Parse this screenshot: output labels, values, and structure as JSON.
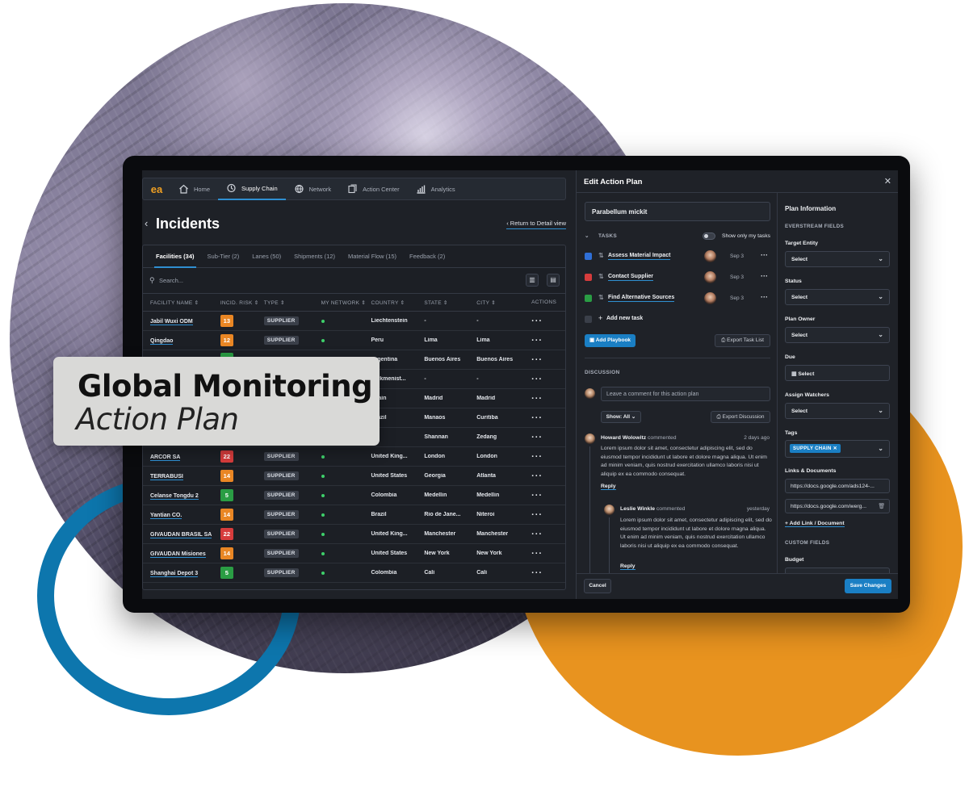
{
  "overlay": {
    "line1": "Global Monitoring",
    "line2": "Action Plan"
  },
  "nav": {
    "logo": "ea",
    "items": [
      {
        "label": "Home",
        "icon": "home-icon"
      },
      {
        "label": "Supply Chain",
        "icon": "supply-chain-icon",
        "active": true
      },
      {
        "label": "Network",
        "icon": "network-icon"
      },
      {
        "label": "Action Center",
        "icon": "action-center-icon"
      },
      {
        "label": "Analytics",
        "icon": "analytics-icon"
      }
    ]
  },
  "page": {
    "title": "Incidents",
    "return_link": "Return to Detail view"
  },
  "tabs": [
    "Facilities (34)",
    "Sub-Tier (2)",
    "Lanes (50)",
    "Shipments (12)",
    "Material Flow (15)",
    "Feedback (2)"
  ],
  "search": {
    "placeholder": "Search..."
  },
  "table": {
    "columns": [
      "FACILITY NAME",
      "INCID. RISK",
      "TYPE",
      "MY NETWORK",
      "COUNTRY",
      "STATE",
      "CITY",
      "ACTIONS"
    ],
    "rows": [
      {
        "name": "Jabil Wuxi ODM",
        "risk": "13",
        "risk_color": "orange",
        "type": "SUPPLIER",
        "country": "Liechtenstein",
        "state": "-",
        "city": "-"
      },
      {
        "name": "Qingdao",
        "risk": "12",
        "risk_color": "orange",
        "type": "SUPPLIER",
        "country": "Peru",
        "state": "Lima",
        "city": "Lima"
      },
      {
        "name": "",
        "risk": "",
        "risk_color": "green",
        "type": "",
        "country": "Argentina",
        "state": "Buenos Aires",
        "city": "Buenos Aires"
      },
      {
        "name": "",
        "risk": "",
        "risk_color": "",
        "type": "",
        "country": "Turkmenist...",
        "state": "-",
        "city": "-"
      },
      {
        "name": "",
        "risk": "",
        "risk_color": "",
        "type": "",
        "country": "Spain",
        "state": "Madrid",
        "city": "Madrid"
      },
      {
        "name": "",
        "risk": "",
        "risk_color": "",
        "type": "",
        "country": "Brazil",
        "state": "Manaos",
        "city": "Curitiba"
      },
      {
        "name": "",
        "risk": "",
        "risk_color": "",
        "type": "",
        "country": "",
        "state": "Shannan",
        "city": "Zedang"
      },
      {
        "name": "ARCOR SA",
        "risk": "22",
        "risk_color": "red",
        "type": "SUPPLIER",
        "country": "United King...",
        "state": "London",
        "city": "London"
      },
      {
        "name": "TERRABUSI",
        "risk": "14",
        "risk_color": "orange",
        "type": "SUPPLIER",
        "country": "United States",
        "state": "Georgia",
        "city": "Atlanta"
      },
      {
        "name": "Celanse Tongdu 2",
        "risk": "5",
        "risk_color": "green",
        "type": "SUPPLIER",
        "country": "Colombia",
        "state": "Medellin",
        "city": "Medellin"
      },
      {
        "name": "Yantian CO.",
        "risk": "14",
        "risk_color": "orange",
        "type": "SUPPLIER",
        "country": "Brazil",
        "state": "Rio de Jane...",
        "city": "Niteroi"
      },
      {
        "name": "GIVAUDAN BRASIL SA",
        "risk": "22",
        "risk_color": "red",
        "type": "SUPPLIER",
        "country": "United King...",
        "state": "Manchester",
        "city": "Manchester"
      },
      {
        "name": "GIVAUDAN Misiones",
        "risk": "14",
        "risk_color": "orange",
        "type": "SUPPLIER",
        "country": "United States",
        "state": "New York",
        "city": "New York"
      },
      {
        "name": "Shanghai Depot 3",
        "risk": "5",
        "risk_color": "green",
        "type": "SUPPLIER",
        "country": "Colombia",
        "state": "Cali",
        "city": "Cali"
      }
    ]
  },
  "edit_panel": {
    "title": "Edit Action Plan",
    "plan_name": "Parabellum mickit",
    "tasks_label": "TASKS",
    "show_only_my_tasks": "Show only my tasks",
    "tasks": [
      {
        "name": "Assess Material Impact",
        "date": "Sep 3",
        "color": "#2f6fd6"
      },
      {
        "name": "Contact Supplier",
        "date": "Sep 3",
        "color": "#d63c3c"
      },
      {
        "name": "Find Alternative Sources",
        "date": "Sep 3",
        "color": "#2a9d44"
      }
    ],
    "add_task": "Add new task",
    "add_playbook": "Add Playbook",
    "export_task_list": "Export Task List",
    "discussion_label": "DISCUSSION",
    "comment_placeholder": "Leave a comment for this action plan",
    "show_filter": "Show: All",
    "export_discussion": "Export Discussion",
    "comments": [
      {
        "author": "Howard Wolowitz",
        "verb": "commented",
        "time": "2 days ago",
        "body": "Lorem ipsum dolor sit amet, consectetur adipiscing elit, sed do eiusmod tempor incididunt ut labore et dolore magna aliqua. Ut enim ad minim veniam, quis nostrud exercitation ullamco laboris nisi ut aliquip ex ea commodo consequat.",
        "reply": "Reply"
      },
      {
        "author": "Leslie Winkle",
        "verb": "commented",
        "time": "yesterday",
        "body": "Lorem ipsum dolor sit amet, consectetur adipiscing elit, sed do eiusmod tempor incididunt ut labore et dolore magna aliqua. Ut enim ad minim veniam, quis nostrud exercitation ullamco laboris nisi ut aliquip ex ea commodo consequat.",
        "reply": "Reply"
      }
    ],
    "cancel": "Cancel",
    "save": "Save Changes"
  },
  "plan_info": {
    "title": "Plan Information",
    "everstream_fields": "EVERSTREAM FIELDS",
    "target_entity": {
      "label": "Target Entity",
      "value": "Select"
    },
    "status": {
      "label": "Status",
      "value": "Select"
    },
    "plan_owner": {
      "label": "Plan Owner",
      "value": "Select"
    },
    "due": {
      "label": "Due",
      "value": "Select"
    },
    "assign_watchers": {
      "label": "Assign Watchers",
      "value": "Select"
    },
    "tags": {
      "label": "Tags",
      "value": "SUPPLY CHAIN"
    },
    "links_label": "Links & Documents",
    "links": [
      "https://docs.google.com/ads124-...",
      "https://docs.google.com/werg..."
    ],
    "add_link": "Add Link / Document",
    "custom_fields": "CUSTOM FIELDS",
    "budget": "Budget"
  },
  "colors": {
    "accent": "#1a7fc4",
    "orange_circle": "#e8931f",
    "blue_ring": "#0d76ad"
  }
}
